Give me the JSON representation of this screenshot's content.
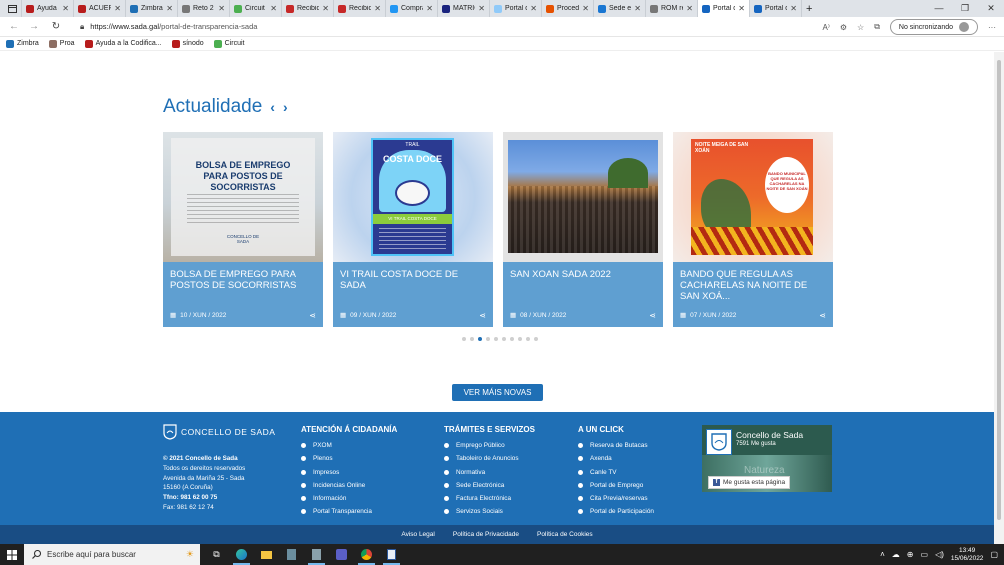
{
  "browser": {
    "tabs": [
      {
        "label": "Ayuda a",
        "color": "#b71c1c"
      },
      {
        "label": "ACUERD",
        "color": "#b71c1c"
      },
      {
        "label": "Zimbra:",
        "color": "#1f6fb5"
      },
      {
        "label": "Reto 2 p",
        "color": "#777"
      },
      {
        "label": "Circuit",
        "color": "#4caf50"
      },
      {
        "label": "Recibido",
        "color": "#c62828"
      },
      {
        "label": "Recibido",
        "color": "#c62828"
      },
      {
        "label": "Compra",
        "color": "#2196f3"
      },
      {
        "label": "MATRÍC",
        "color": "#1a237e"
      },
      {
        "label": "Portal d",
        "color": "#90caf9"
      },
      {
        "label": "Proced",
        "color": "#e65100"
      },
      {
        "label": "Sede el",
        "color": "#1976d2"
      },
      {
        "label": "ROM re",
        "color": "#777"
      },
      {
        "label": "Portal d",
        "color": "#1565c0",
        "active": true
      },
      {
        "label": "Portal d",
        "color": "#1565c0"
      }
    ],
    "url_host": "https://www.sada.gal",
    "url_path": "/portal-de-transparencia-sada",
    "sync_label": "No sincronizando",
    "bookmarks": [
      {
        "label": "Zimbra",
        "color": "#1f6fb5"
      },
      {
        "label": "Proa",
        "color": "#8d6e63"
      },
      {
        "label": "Ayuda a la Codifica...",
        "color": "#b71c1c"
      },
      {
        "label": "sínodo",
        "color": "#b71c1c"
      },
      {
        "label": "Circuit",
        "color": "#4caf50"
      }
    ]
  },
  "news": {
    "heading": "Actualidade",
    "prev": "‹",
    "next": "›",
    "items": [
      {
        "title": "BOLSA DE EMPREGO PARA POSTOS DE SOCORRISTAS",
        "date": "10 / XUN / 2022"
      },
      {
        "title": "VI TRAIL COSTA DOCE DE SADA",
        "date": "09 / XUN / 2022"
      },
      {
        "title": "SAN XOAN SADA 2022",
        "date": "08 / XUN / 2022"
      },
      {
        "title": "BANDO QUE REGULA AS CACHARELAS NA NOITE DE SAN XOÁ...",
        "date": "07 / XUN / 2022"
      }
    ],
    "poster1_title": "BOLSA DE EMPREGO PARA POSTOS DE SOCORRISTAS",
    "poster1_footer": "CONCELLO DE SADA",
    "poster2_top": "TRAIL",
    "poster2_title": "COSTA DOCE",
    "poster2_sub": "VI TRAIL COSTA DOCE",
    "poster4_header": "NOITE MEIGA DE SAN XOÁN",
    "poster4_bubble": "BANDO MUNICIPAL QUE REGULA AS CACHARELAS NA NOITE DE SAN XOÁN",
    "more_label": "VER MÁIS NOVAS",
    "dots_count": 10,
    "active_dot": 2
  },
  "footer": {
    "logo_text": "CONCELLO DE SADA",
    "address": [
      "© 2021 Concello de Sada",
      "Todos os dereitos reservados",
      "Avenida da Mariña 25 - Sada",
      "15160 (A Coruña)",
      "Tfno: 981 62 00 75",
      "Fax: 981 62 12 74"
    ],
    "columns": [
      {
        "title": "ATENCIÓN Á CIDADANÍA",
        "items": [
          "PXOM",
          "Plenos",
          "Impresos",
          "Incidencias Online",
          "Información",
          "Portal Transparencia"
        ]
      },
      {
        "title": "TRÁMITES E SERVIZOS",
        "items": [
          "Emprego Público",
          "Taboleiro de Anuncios",
          "Normativa",
          "Sede Electrónica",
          "Factura Electrónica",
          "Servizos Sociais"
        ]
      },
      {
        "title": "A UN CLICK",
        "items": [
          "Reserva de Butacas",
          "Axenda",
          "Canle TV",
          "Portal de Emprego",
          "Cita Previa/reservas",
          "Portal de Participación"
        ]
      }
    ],
    "facebook": {
      "name": "Concello de Sada",
      "likes": "7591 Me gusta",
      "overlay": "Natureza",
      "like_button": "Me gusta esta página"
    },
    "links": [
      "Aviso Legal",
      "Política de Privacidade",
      "Política de Cookies"
    ]
  },
  "taskbar": {
    "search_placeholder": "Escribe aquí para buscar",
    "time": "13:49",
    "date": "15/06/2022"
  }
}
